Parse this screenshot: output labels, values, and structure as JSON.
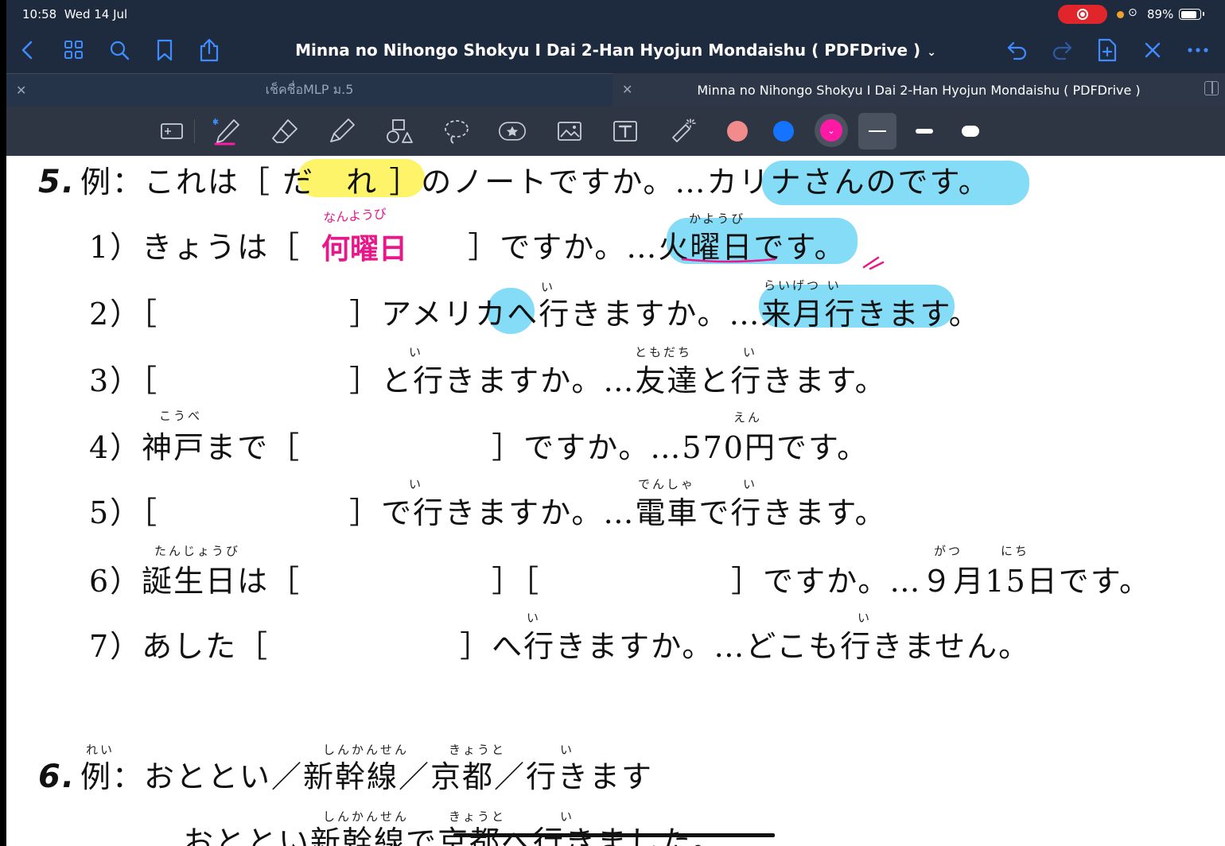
{
  "status": {
    "time": "10:58",
    "date": "Wed 14 Jul",
    "battery": "89%"
  },
  "nav": {
    "title": "Minna no Nihongo Shokyu I Dai 2-Han Hyojun Mondaishu ( PDFDrive )"
  },
  "tabs": [
    {
      "label": "เช็คชื่อMLP ม.5"
    },
    {
      "label": "Minna no Nihongo Shokyu I Dai 2-Han Hyojun Mondaishu ( PDFDrive )"
    }
  ],
  "toolbar": {
    "colors": [
      "#f28b8b",
      "#1473ff",
      "#ff1aa6"
    ],
    "selected_color": "#ff1aa6"
  },
  "document": {
    "s5_num": "5.",
    "s5_example": "例：これは［",
    "s5_example_answer": "だ　れ",
    "s5_example_rest": "］のノートですか。…カリナさんのです。",
    "q1_a": "1）きょうは［",
    "q1_b": "］ですか。…火曜日です。",
    "q1_furi": "かようび",
    "q1_ink_answer": "何曜日",
    "q1_ink_furi": "なんようび",
    "q2": "2）［　　　　　　］アメリカへ行きますか。…来月行きます。",
    "q2_furi_a": "い",
    "q2_furi_b": "らいげつ い",
    "q3": "3）［　　　　　　］と行きますか。…友達と行きます。",
    "q3_furi_a": "い",
    "q3_furi_b": "ともだち",
    "q3_furi_c": "い",
    "q4": "4）神戸まで［　　　　　　］ですか。…570円です。",
    "q4_furi_a": "こうべ",
    "q4_furi_b": "えん",
    "q5": "5）［　　　　　　］で行きますか。…電車で行きます。",
    "q5_furi_a": "い",
    "q5_furi_b": "でんしゃ",
    "q5_furi_c": "い",
    "q6": "6）誕生日は［　　　　　　］［　　　　　　］ですか。…９月15日です。",
    "q6_furi_a": "たんじょうび",
    "q6_furi_b": "がつ",
    "q6_furi_c": "にち",
    "q7": "7）あした［　　　　　　］へ行きますか。…どこも行きません。",
    "q7_furi_a": "い",
    "q7_furi_b": "い",
    "s6_num": "6.",
    "s6_example": "例：おととい／新幹線／京都／行きます",
    "s6_furi_a": "れい",
    "s6_furi_b": "しんかんせん",
    "s6_furi_c": "きょうと",
    "s6_furi_d": "い",
    "s6_answer": "…おととい新幹線で京都へ行きました。",
    "s6_ans_furi_a": "しんかんせん",
    "s6_ans_furi_b": "きょうと",
    "s6_ans_furi_c": "い"
  }
}
